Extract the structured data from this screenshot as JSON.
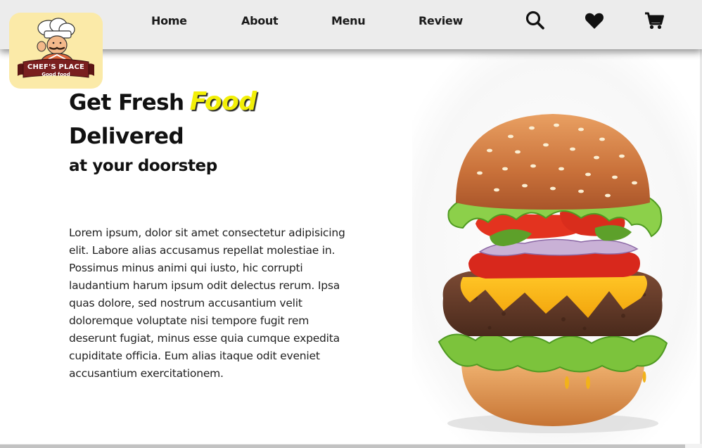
{
  "brand": {
    "name": "CHEF'S PLACE",
    "tagline": "Good food"
  },
  "nav": {
    "links": [
      {
        "label": "Home"
      },
      {
        "label": "About"
      },
      {
        "label": "Menu"
      },
      {
        "label": "Review"
      }
    ],
    "icons": [
      "search-icon",
      "heart-icon",
      "cart-icon"
    ]
  },
  "hero": {
    "title_prefix": "Get Fresh",
    "title_highlight": "Food",
    "title_line2": "Delivered",
    "subtitle": "at your doorstep",
    "body": "Lorem ipsum, dolor sit amet consectetur adipisicing elit. Labore alias accusamus repellat molestiae in. Possimus minus animi qui iusto, hic corrupti laudantium harum ipsum odit delectus rerum. Ipsa quas dolore, sed nostrum accusantium velit doloremque voluptate nisi tempore fugit rem deserunt fugiat, minus esse quia cumque expedita cupiditate officia. Eum alias itaque odit eveniet accusantium exercitationem."
  },
  "colors": {
    "navbar_bg": "#ececec",
    "highlight": "#f2ef08",
    "logo_bg": "#fbeaa8",
    "logo_banner": "#7a1f1f"
  }
}
